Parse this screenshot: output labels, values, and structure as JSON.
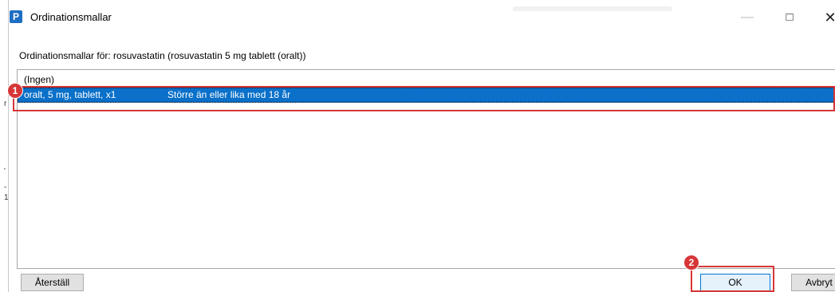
{
  "window": {
    "app_icon_letter": "P",
    "title": "Ordinationsmallar",
    "controls": {
      "minimize": "—",
      "maximize": "□",
      "close": "✕"
    }
  },
  "header": {
    "label": "Ordinationsmallar för: rosuvastatin (rosuvastatin 5 mg tablett (oralt))"
  },
  "list": {
    "none_item": "(Ingen)",
    "selected_item": {
      "dose": "oralt, 5 mg, tablett, x1",
      "criteria": "Större än eller lika med 18 år"
    }
  },
  "annotations": {
    "badge_1": "1",
    "badge_2": "2",
    "color": "#d63638"
  },
  "buttons": {
    "reset": "Återställ",
    "ok": "OK",
    "cancel": "Avbryt"
  },
  "left_marks": [
    "r",
    "'",
    "-",
    "1"
  ],
  "colors": {
    "selection": "#0a70c9",
    "accent": "#0078d7"
  }
}
